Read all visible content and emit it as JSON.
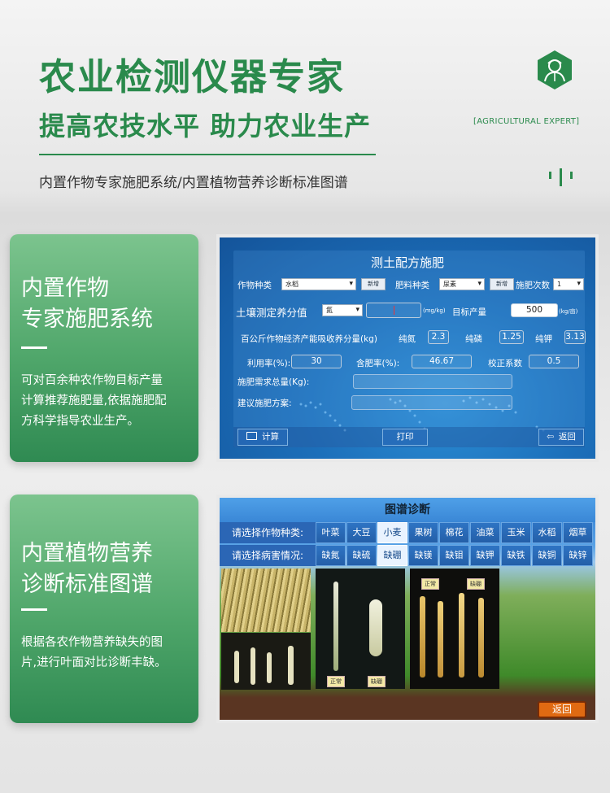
{
  "header": {
    "title": "农业检测仪器专家",
    "subtitle": "提高农技水平  助力农业生产",
    "description": "内置作物专家施肥系统/内置植物营养诊断标准图谱",
    "brand_en": "[AGRICULTURAL EXPERT]",
    "logo_icon": "farmer-hexagon-icon",
    "accent_color": "#2a8a4c"
  },
  "card1": {
    "heading_line1": "内置作物",
    "heading_line2": "专家施肥系统",
    "text_line1": "可对百余种农作物目标产量",
    "text_line2": "计算推荐施肥量,依据施肥配",
    "text_line3": "方科学指导农业生产。"
  },
  "card2": {
    "heading_line1": "内置植物营养",
    "heading_line2": "诊断标准图谱",
    "text_line1": "根据各农作物营养缺失的图",
    "text_line2": "片,进行叶面对比诊断丰缺。"
  },
  "screen1": {
    "title": "测土配方施肥",
    "crop_type_label": "作物种类",
    "crop_type_value": "水稻",
    "add_label": "新增",
    "fertilizer_type_label": "肥料种类",
    "fertilizer_type_value": "尿素",
    "times_label": "施肥次数",
    "times_value": "1",
    "soil_label": "土壤测定养分值",
    "soil_select_value": "氮",
    "soil_unit": "(mg/kg)",
    "target_label": "目标产量",
    "target_value": "500",
    "target_unit": "(kg/亩)",
    "absorb_label": "百公斤作物经济产能吸收养分量(kg)",
    "n_label": "纯氮",
    "n_value": "2.3",
    "p_label": "纯磷",
    "p_value": "1.25",
    "k_label": "纯钾",
    "k_value": "3.13",
    "util_label": "利用率(%):",
    "util_value": "30",
    "content_label": "含肥率(%):",
    "content_value": "46.67",
    "coef_label": "校正系数",
    "coef_value": "0.5",
    "total_label": "施肥需求总量(Kg):",
    "plan_label": "建议施肥方案:",
    "calc_label": "计算",
    "print_label": "打印",
    "back_label": "返回"
  },
  "screen2": {
    "title": "图谱诊断",
    "crop_prompt": "请选择作物种类:",
    "crops": [
      "叶菜",
      "大豆",
      "小麦",
      "果树",
      "棉花",
      "油菜",
      "玉米",
      "水稻",
      "烟草"
    ],
    "selected_crop": "小麦",
    "disease_prompt": "请选择病害情况:",
    "deficiencies": [
      "缺氮",
      "缺硫",
      "缺硼",
      "缺镁",
      "缺钼",
      "缺钾",
      "缺铁",
      "缺铜",
      "缺锌"
    ],
    "selected_deficiency": "缺硼",
    "photo_tag_1": "正常",
    "photo_tag_2": "缺硼",
    "photo_tag_3": "正常",
    "photo_tag_4": "缺硼",
    "back_label": "返回"
  }
}
